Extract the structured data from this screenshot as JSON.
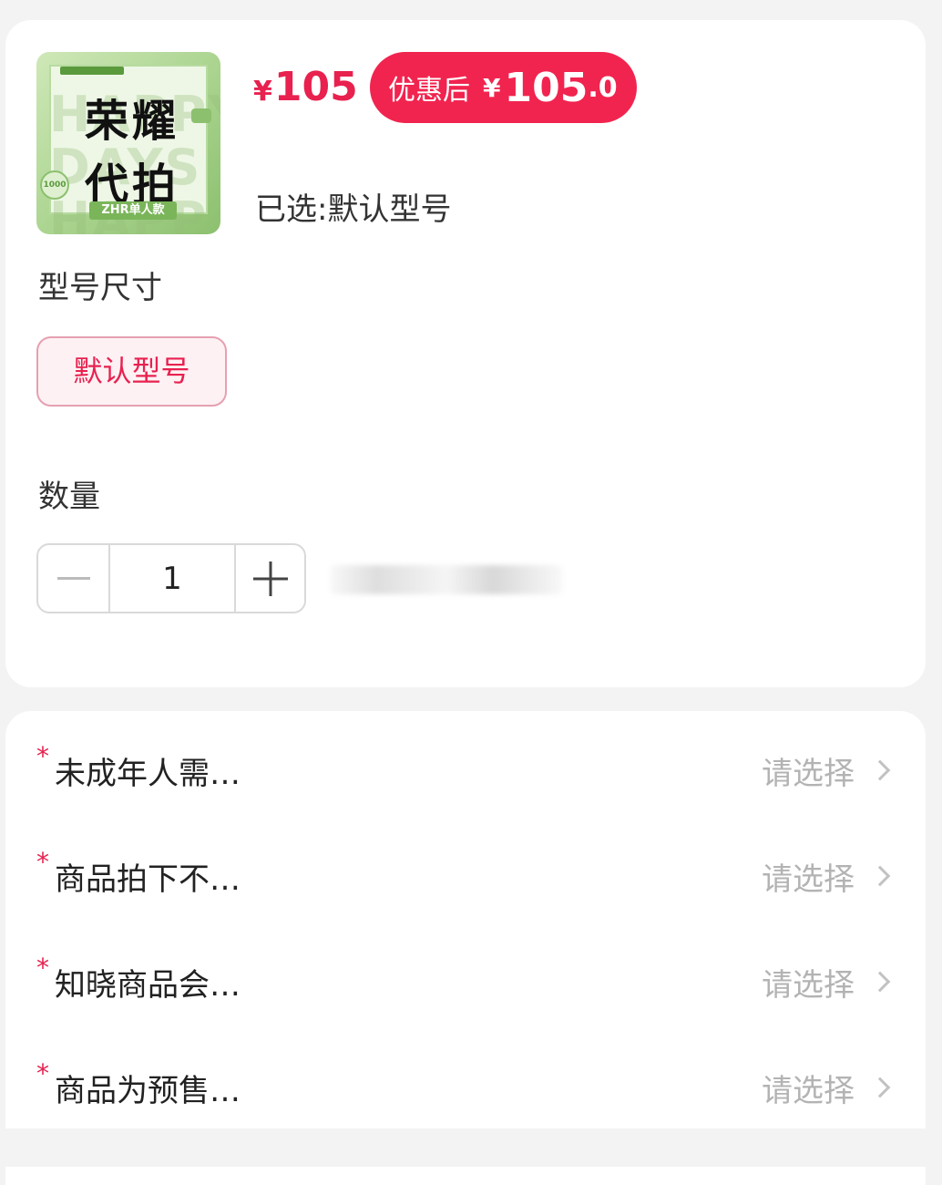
{
  "product": {
    "thumbnail": {
      "title_line1": "荣耀",
      "title_line2": "代拍",
      "subtitle": "ZHR单人款"
    },
    "price_symbol": "¥",
    "price": "105",
    "promo": {
      "label": "优惠后",
      "symbol": "¥",
      "integer": "105",
      "decimal": ".0"
    },
    "selected_text": "已选:默认型号"
  },
  "spec": {
    "title": "型号尺寸",
    "options": [
      "默认型号"
    ]
  },
  "quantity": {
    "title": "数量",
    "value": "1"
  },
  "form_rows": [
    {
      "required": "*",
      "label": "未成年人需…",
      "value": "请选择"
    },
    {
      "required": "*",
      "label": "商品拍下不…",
      "value": "请选择"
    },
    {
      "required": "*",
      "label": "知晓商品会…",
      "value": "请选择"
    },
    {
      "required": "*",
      "label": "商品为预售…",
      "value": "请选择"
    }
  ],
  "colors": {
    "accent": "#e8214f",
    "promo_bg": "#f1244f",
    "option_bg": "#fdf1f4",
    "placeholder": "#b3b3b3"
  }
}
